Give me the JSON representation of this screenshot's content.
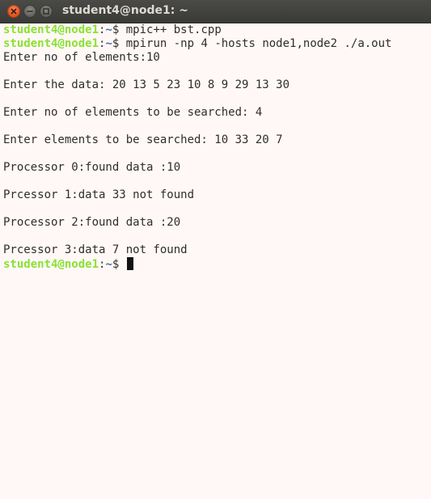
{
  "window": {
    "title": "student4@node1: ~"
  },
  "prompt": {
    "user_host": "student4@node1",
    "colon": ":",
    "path": "~",
    "symbol": "$ "
  },
  "terminal": {
    "command_1": "mpic++ bst.cpp",
    "command_2": "mpirun -np 4 -hosts node1,node2 ./a.out",
    "output": [
      "Enter no of elements:10",
      "",
      "Enter the data: 20 13 5 23 10 8 9 29 13 30",
      "",
      "Enter no of elements to be searched: 4",
      "",
      "Enter elements to be searched: 10 33 20 7",
      "",
      "Processor 0:found data :10",
      "",
      "Prcessor 1:data 33 not found",
      "",
      "Processor 2:found data :20",
      "",
      "Prcessor 3:data 7 not found"
    ]
  },
  "colors": {
    "background": "#fff8f6",
    "prompt_user": "#8ae234",
    "prompt_path": "#4b6fa8",
    "close_button": "#e0511d"
  },
  "icons": {
    "close": "close-icon",
    "minimize": "minimize-icon",
    "maximize": "maximize-icon"
  }
}
